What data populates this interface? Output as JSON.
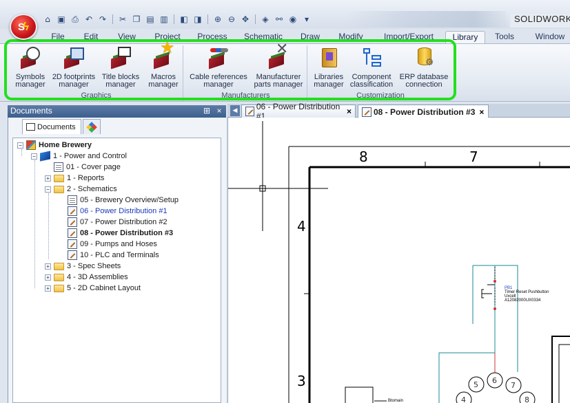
{
  "app": {
    "title": "SOLIDWORKS",
    "logo": "S"
  },
  "menu": [
    "File",
    "Edit",
    "View",
    "Project",
    "Process",
    "Schematic",
    "Draw",
    "Modify",
    "Import/Export",
    "Library",
    "Tools",
    "Window"
  ],
  "active_menu": "Library",
  "ribbon": {
    "groups": [
      {
        "label": "Graphics",
        "buttons": [
          {
            "line1": "Symbols",
            "line2": "manager",
            "icon": "symbols-manager-icon"
          },
          {
            "line1": "2D footprints",
            "line2": "manager",
            "icon": "2d-footprints-icon"
          },
          {
            "line1": "Title blocks",
            "line2": "manager",
            "icon": "title-blocks-icon"
          },
          {
            "line1": "Macros",
            "line2": "manager",
            "icon": "macros-star-icon"
          }
        ]
      },
      {
        "label": "Manufacturers",
        "buttons": [
          {
            "line1": "Cable references",
            "line2": "manager",
            "icon": "cable-references-icon"
          },
          {
            "line1": "Manufacturer",
            "line2": "parts manager",
            "icon": "manufacturer-parts-icon"
          }
        ]
      },
      {
        "label": "Customization",
        "buttons": [
          {
            "line1": "Libraries",
            "line2": "manager",
            "icon": "libraries-icon"
          },
          {
            "line1": "Component",
            "line2": "classification",
            "icon": "component-classification-icon"
          },
          {
            "line1": "ERP database",
            "line2": "connection",
            "icon": "erp-database-icon"
          }
        ]
      }
    ]
  },
  "documents_panel": {
    "title": "Documents",
    "pin": "⊞",
    "close": "×",
    "tabs": [
      {
        "label": "Documents"
      },
      {
        "label": ""
      }
    ],
    "tree": [
      {
        "label": "Home Brewery",
        "level": 0,
        "icon": "project",
        "expander": "−",
        "bold": true
      },
      {
        "label": "1 - Power and Control",
        "level": 1,
        "icon": "book",
        "expander": "−"
      },
      {
        "label": "01 - Cover page",
        "level": 2,
        "icon": "doc",
        "expander": ""
      },
      {
        "label": "1 - Reports",
        "level": 2,
        "icon": "folder",
        "expander": "+"
      },
      {
        "label": "2 - Schematics",
        "level": 2,
        "icon": "folder",
        "expander": "−"
      },
      {
        "label": "05 - Brewery Overview/Setup",
        "level": 3,
        "icon": "doc",
        "expander": ""
      },
      {
        "label": "06 - Power Distribution #1",
        "level": 3,
        "icon": "schematic",
        "expander": "",
        "link": true
      },
      {
        "label": "07 - Power Distribution #2",
        "level": 3,
        "icon": "schematic",
        "expander": ""
      },
      {
        "label": "08 - Power Distribution #3",
        "level": 3,
        "icon": "schematic",
        "expander": "",
        "bold": true
      },
      {
        "label": "09 - Pumps and Hoses",
        "level": 3,
        "icon": "schematic",
        "expander": ""
      },
      {
        "label": "10 - PLC and Terminals",
        "level": 3,
        "icon": "schematic",
        "expander": ""
      },
      {
        "label": "3 - Spec Sheets",
        "level": 2,
        "icon": "folder",
        "expander": "+"
      },
      {
        "label": "4 - 3D Assemblies",
        "level": 2,
        "icon": "folder",
        "expander": "+"
      },
      {
        "label": "5 - 2D Cabinet Layout",
        "level": 2,
        "icon": "folder",
        "expander": "+"
      }
    ]
  },
  "sheet_tabs": [
    {
      "label": "06 - Power Distribution #1",
      "close": "×",
      "active": false
    },
    {
      "label": "08 - Power Distribution #3",
      "close": "×",
      "active": true
    }
  ],
  "drawing": {
    "column_labels": [
      "8",
      "7"
    ],
    "row_labels": [
      "4",
      "3"
    ],
    "component_tag": "PB1",
    "component_desc": [
      "Timer Reset Pushbutton",
      "Uxcell",
      "A12082000UX0334"
    ],
    "terminal_numbers": [
      "5",
      "6",
      "7",
      "4",
      "8"
    ],
    "small_label": "Btomain"
  }
}
